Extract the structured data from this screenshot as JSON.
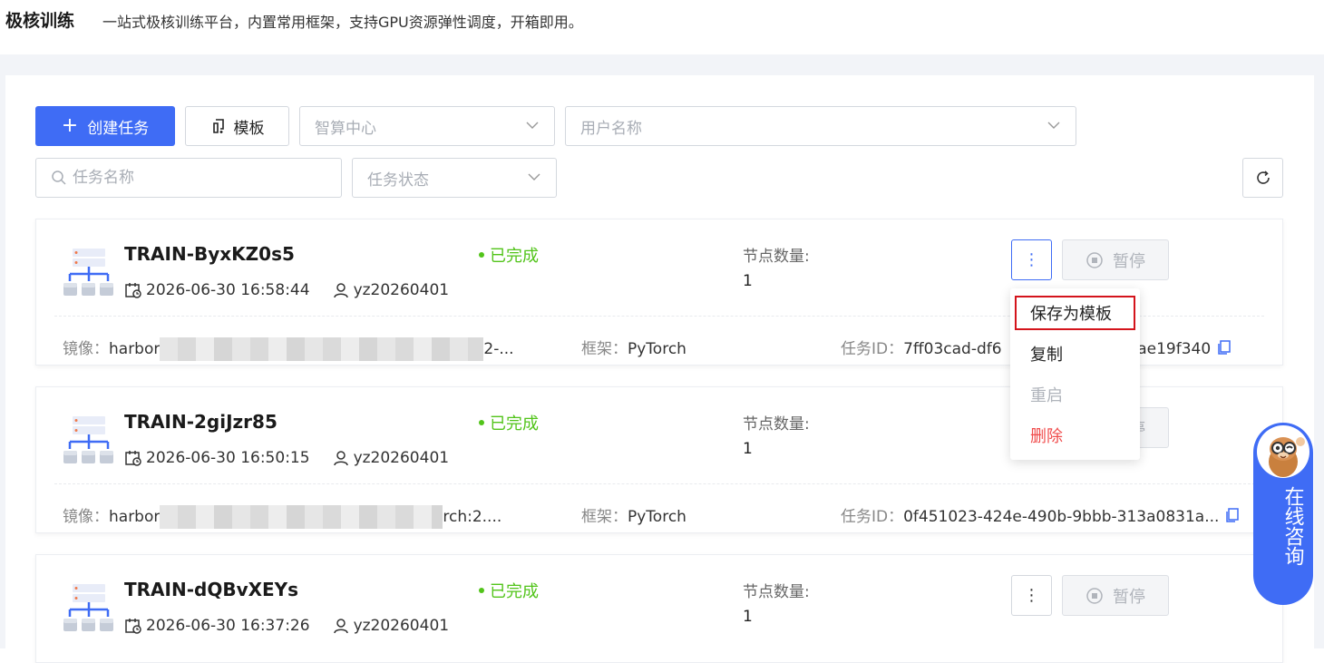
{
  "header": {
    "title": "极核训练",
    "subtitle": "一站式极核训练平台，内置常用框架，支持GPU资源弹性调度，开箱即用。"
  },
  "toolbar": {
    "create_label": "创建任务",
    "template_label": "模板",
    "center_placeholder": "智算中心",
    "user_placeholder": "用户名称",
    "search_placeholder": "任务名称",
    "status_placeholder": "任务状态"
  },
  "labels": {
    "nodes": "节点数量:",
    "image": "镜像：",
    "framework": "框架：",
    "task_id": "任务ID：",
    "pause": "暂停"
  },
  "tasks": [
    {
      "name": "TRAIN-ByxKZ0s5",
      "time": "2026-06-30 16:58:44",
      "user": "yz20260401",
      "status": "已完成",
      "nodes": "1",
      "image_prefix": "harbor",
      "image_suffix": "2-...",
      "framework": "PyTorch",
      "task_id": "7ff03cad-df6",
      "task_id_tail": "51ae19f340"
    },
    {
      "name": "TRAIN-2giJzr85",
      "time": "2026-06-30 16:50:15",
      "user": "yz20260401",
      "status": "已完成",
      "nodes": "1",
      "image_prefix": "harbor",
      "image_suffix": "rch:2....",
      "framework": "PyTorch",
      "task_id": "0f451023-424e-490b-9bbb-313a0831a...",
      "task_id_tail": ""
    },
    {
      "name": "TRAIN-dQBvXEYs",
      "time": "2026-06-30 16:37:26",
      "user": "yz20260401",
      "status": "已完成",
      "nodes": "1"
    }
  ],
  "dropdown": {
    "items": [
      "保存为模板",
      "复制",
      "重启",
      "删除"
    ]
  },
  "consult": {
    "label": "在线咨询"
  },
  "colors": {
    "primary": "#3f6cf5",
    "success": "#52c41a",
    "danger": "#f04b4b",
    "highlight": "#d4141c"
  }
}
